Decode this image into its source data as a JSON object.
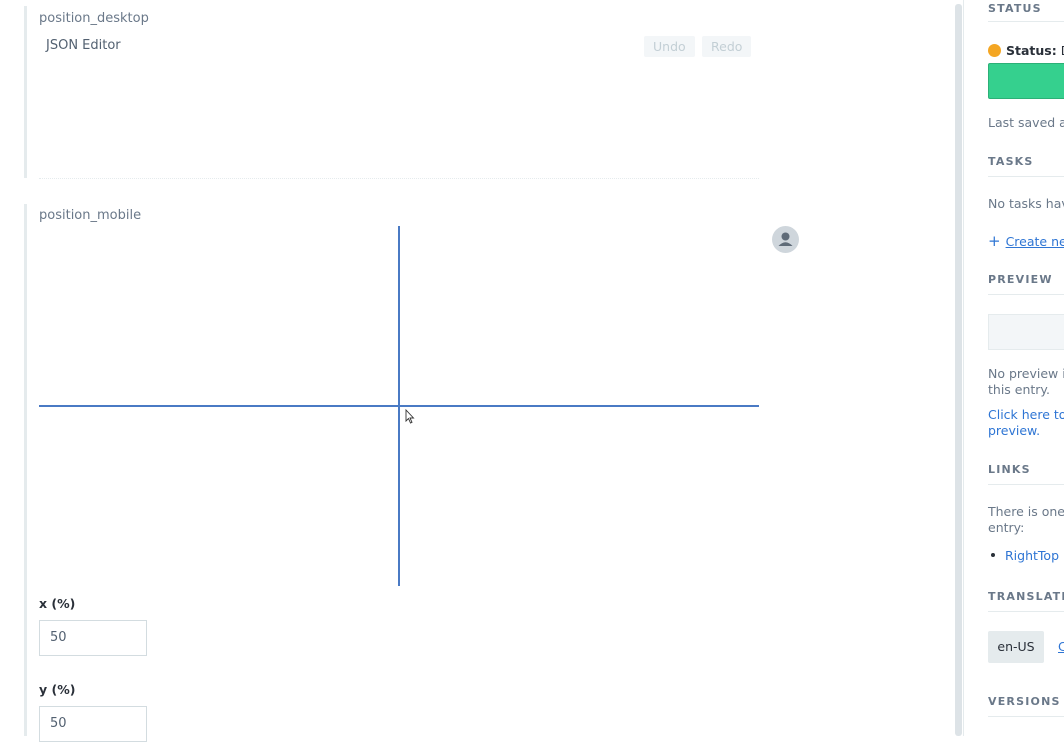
{
  "fields": {
    "desktop": {
      "label": "position_desktop",
      "editor_title": "JSON Editor",
      "undo_label": "Undo",
      "redo_label": "Redo"
    },
    "mobile": {
      "label": "position_mobile",
      "x_label": "x  (%)",
      "x_value": "50",
      "y_label": "y  (%)",
      "y_value": "50",
      "crosshair_x_percent": 50,
      "crosshair_y_percent": 50,
      "line_color": "#4a7ac4"
    }
  },
  "sidebar": {
    "status": {
      "heading": "STATUS",
      "status_key": "Status:",
      "status_value": "D",
      "dot_color": "#f4a623",
      "button_color": "#35d08e",
      "last_saved": "Last saved a"
    },
    "tasks": {
      "heading": "TASKS",
      "empty_text": "No tasks hav",
      "create_label": "Create ne"
    },
    "preview": {
      "heading": "PREVIEW",
      "text_line1": "No preview is",
      "text_line2": "this entry.",
      "link_line1": "Click here to",
      "link_line2": "preview."
    },
    "links": {
      "heading": "LINKS",
      "text_line1": "There is one",
      "text_line2": "entry:",
      "item": "RightTop"
    },
    "translation": {
      "heading": "TRANSLATIO",
      "locale": "en-US",
      "change_label": "C"
    },
    "versions": {
      "heading": "VERSIONS"
    }
  }
}
